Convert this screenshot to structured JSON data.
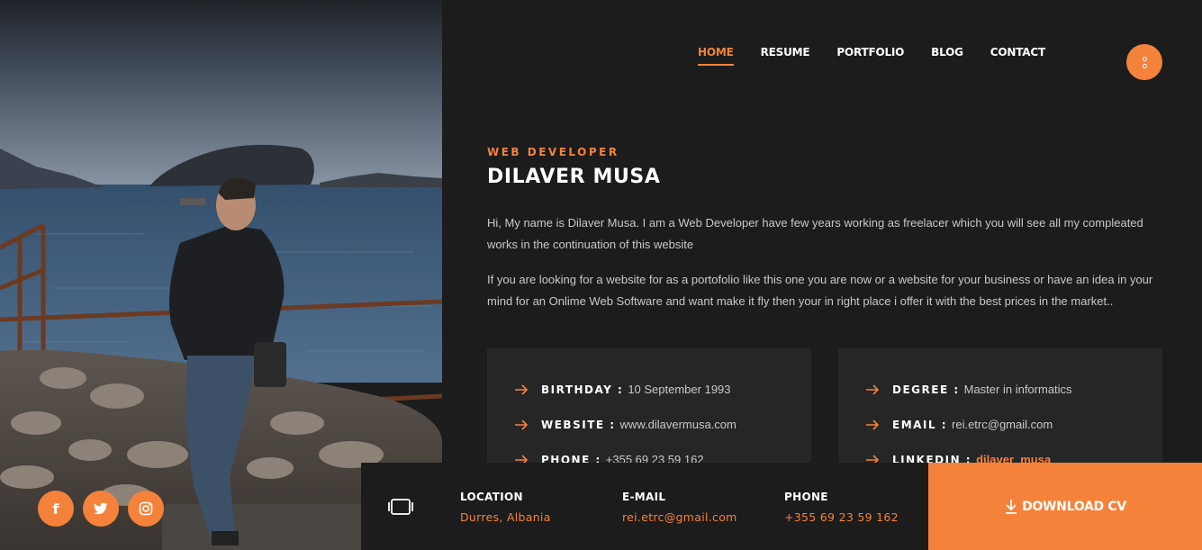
{
  "nav": {
    "items": [
      {
        "label": "HOME",
        "active": true
      },
      {
        "label": "RESUME",
        "active": false
      },
      {
        "label": "PORTFOLIO",
        "active": false
      },
      {
        "label": "BLOG",
        "active": false
      },
      {
        "label": "CONTACT",
        "active": false
      }
    ]
  },
  "hero": {
    "subtitle": "WEB DEVELOPER",
    "name": "DILAVER MUSA",
    "paragraph1": "Hi, My name is Dilaver Musa. I am a Web Developer have few years working as freelacer which you will see all my compleated works in the continuation of this website",
    "paragraph2": "If you are looking for a website for as a portofolio like this one you are now or a website for your business or have an idea in your mind for an Onlime Web Software and want make it fly then your in right place i offer it with the best prices in the market.."
  },
  "info_left": [
    {
      "key": "BIRTHDAY :",
      "value": "10 September 1993"
    },
    {
      "key": "WEBSITE :",
      "value": "www.dilavermusa.com"
    },
    {
      "key": "PHONE :",
      "value": "+355 69 23 59 162"
    }
  ],
  "info_right": [
    {
      "key": "DEGREE :",
      "value": "Master in informatics"
    },
    {
      "key": "EMAIL :",
      "value": "rei.etrc@gmail.com"
    },
    {
      "key": "LINKEDIN :",
      "value": "dilaver_musa"
    }
  ],
  "contact": {
    "location_label": "LOCATION",
    "location_value": "Durres, Albania",
    "email_label": "E-MAIL",
    "email_value": "rei.etrc@gmail.com",
    "phone_label": "PHONE",
    "phone_value": "+355 69 23 59 162"
  },
  "download_label": "DOWNLOAD CV",
  "social": [
    "facebook-icon",
    "twitter-icon",
    "instagram-icon"
  ],
  "colors": {
    "accent": "#f5823a",
    "background": "#1c1c1d",
    "box": "#262627"
  }
}
